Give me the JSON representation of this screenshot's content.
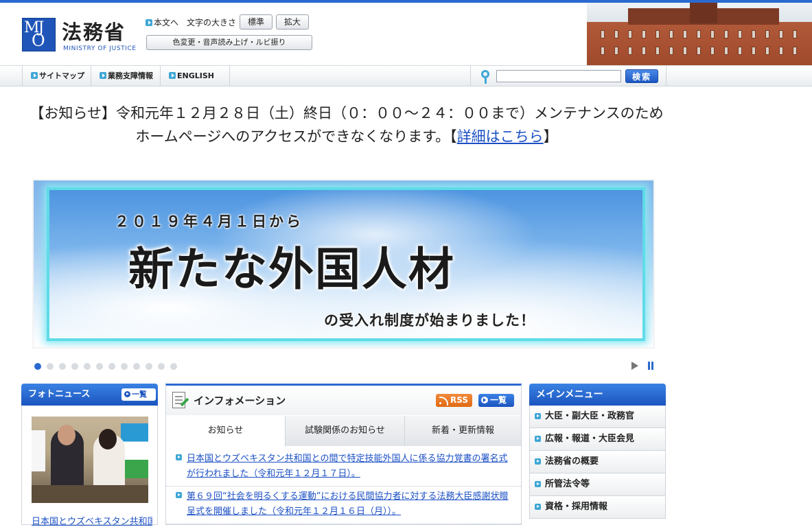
{
  "header": {
    "logo_title": "法務省",
    "logo_sub": "MINISTRY OF JUSTICE",
    "skip_link": "本文へ",
    "font_size_label": "文字の大きさ",
    "font_standard": "標準",
    "font_large": "拡大",
    "accessibility_button": "色変更・音声読み上げ・ルビ振り"
  },
  "nav": {
    "items": [
      "サイトマップ",
      "業務支障情報",
      "ENGLISH"
    ],
    "search_placeholder": "",
    "search_button": "検索"
  },
  "notice": {
    "line1": "【お知らせ】令和元年１２月２８日（土）終日（０：００～２４：００まで）メンテナンスのため",
    "line2_pre": "ホームページへのアクセスができなくなります。【",
    "link": "詳細はこちら",
    "line2_post": "】"
  },
  "banner": {
    "line1": "２０１９年４月１日から",
    "main": "新たな外国人材",
    "sub": "の受入れ制度が始まりました！"
  },
  "slider": {
    "dot_count": 12,
    "active_index": 0
  },
  "photo_news": {
    "title": "フォトニュース",
    "list_button": "一覧",
    "caption": "日本国とウズベキスタン共和国との間で"
  },
  "information": {
    "title": "インフォメーション",
    "rss_button": "RSS",
    "list_button": "一覧",
    "tabs": [
      "お知らせ",
      "試験関係のお知らせ",
      "新着・更新情報"
    ],
    "items": [
      "日本国とウズベキスタン共和国との間で特定技能外国人に係る協力覚書の署名式が行われました（令和元年１２月１７日）。",
      "第６９回“社会を明るくする運動”における民間協力者に対する法務大臣感謝状贈呈式を開催しました（令和元年１２月１６日（月））。"
    ]
  },
  "main_menu": {
    "title": "メインメニュー",
    "items": [
      "大臣・副大臣・政務官",
      "広報・報道・大臣会見",
      "法務省の概要",
      "所管法令等",
      "資格・採用情報"
    ]
  },
  "colors": {
    "accent": "#2a6ad0",
    "link": "#1a4fc4",
    "rss": "#e06a14"
  }
}
